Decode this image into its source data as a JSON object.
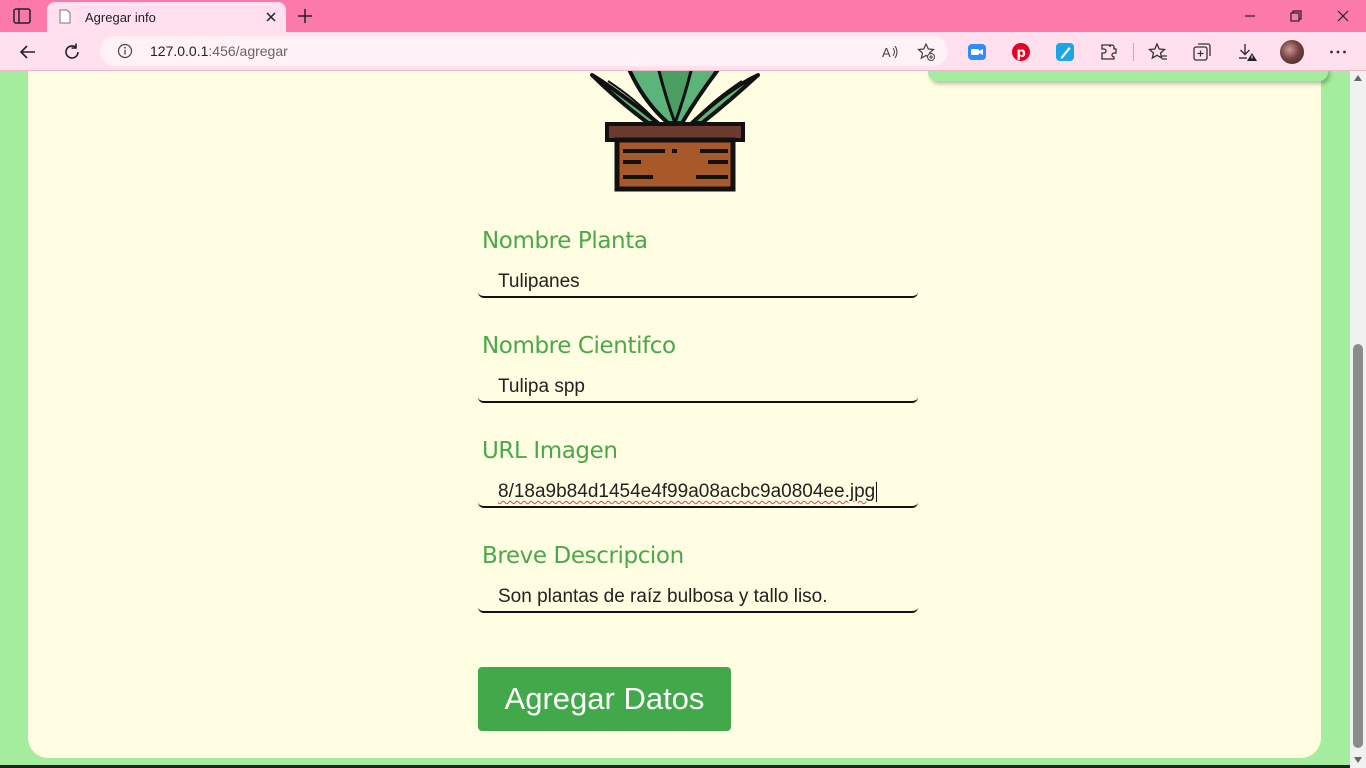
{
  "browser": {
    "tab_title": "Agregar info",
    "url_host": "127.0.0.1",
    "url_path": ":456/agregar",
    "colors": {
      "tabbar": "#fb7aa8",
      "toolbar": "#ffe0ec"
    }
  },
  "form": {
    "fields": [
      {
        "label": "Nombre Planta",
        "value": "Tulipanes"
      },
      {
        "label": "Nombre Cientifco",
        "value": "Tulipa spp"
      },
      {
        "label": "URL Imagen",
        "value": "8/18a9b84d1454e4f99a08acbc9a0804ee.jpg"
      },
      {
        "label": "Breve Descripcion",
        "value": "Son plantas de raíz bulbosa y tallo liso."
      }
    ],
    "submit_label": "Agregar Datos"
  },
  "colors": {
    "page_bg": "#a4ec9e",
    "card_bg": "#fffde2",
    "label": "#4aa84a",
    "button": "#41a94a"
  }
}
